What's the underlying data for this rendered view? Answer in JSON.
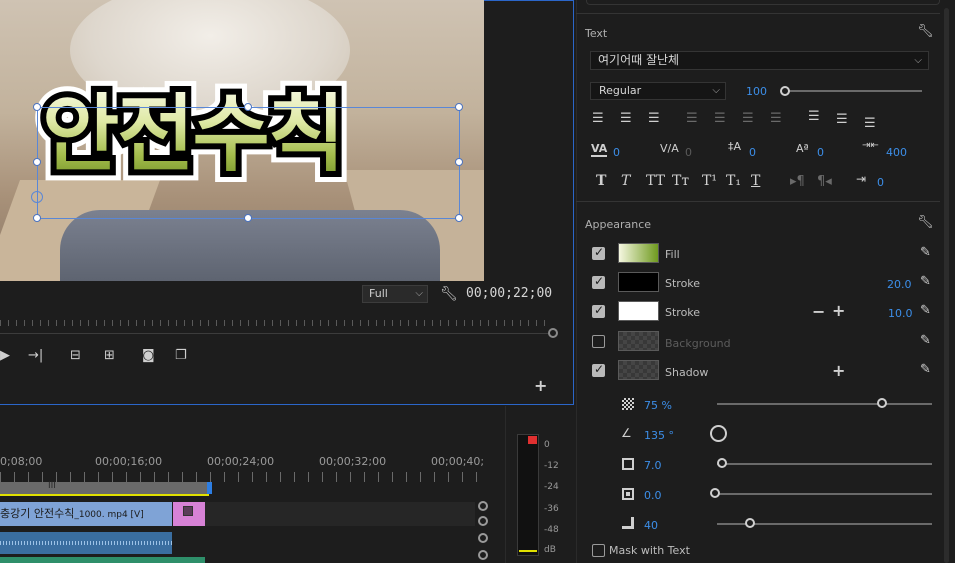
{
  "monitor": {
    "title_text": "안전수칙",
    "zoom": "Full",
    "timecode": "00;00;22;00"
  },
  "timeline": {
    "time_labels": [
      "0;08;00",
      "00;00;16;00",
      "00;00;24;00",
      "00;00;32;00",
      "00;00;40;"
    ],
    "work_marker": "III",
    "video_clip": "충강기 안전수칙",
    "video_clip_suffix": "_1000. mp4 [V]"
  },
  "meter": {
    "labels": [
      "0",
      "-12",
      "-24",
      "-36",
      "-48",
      "dB"
    ],
    "colors": {
      "peak": "#e03030",
      "floor": "#e1e100"
    }
  },
  "text_section": {
    "title": "Text",
    "font": "여기어때 잘난체",
    "style": "Regular",
    "size": "100",
    "tracking": "0",
    "kerning": "0",
    "leading": "0",
    "baseline": "0",
    "tsume": "400",
    "tab": "0",
    "font_size_fraction": 0.0
  },
  "appearance": {
    "title": "Appearance",
    "fill_label": "Fill",
    "stroke1_label": "Stroke",
    "stroke1_value": "20.0",
    "stroke2_label": "Stroke",
    "stroke2_value": "10.0",
    "background_label": "Background",
    "shadow_label": "Shadow",
    "opacity": "75 %",
    "angle": "135 °",
    "distance": "7.0",
    "size": "0.0",
    "blur": "40",
    "mask_label": "Mask with Text",
    "colors": {
      "stroke1": "#000000",
      "stroke2": "#ffffff",
      "fill_from": "#f5f7e0",
      "fill_to": "#6f9a1f",
      "accent": "#3c8ee8"
    }
  },
  "icons": [
    "wrench-icon",
    "eyedropper-icon",
    "plus-icon",
    "minus-icon",
    "play-icon",
    "camera-icon"
  ]
}
